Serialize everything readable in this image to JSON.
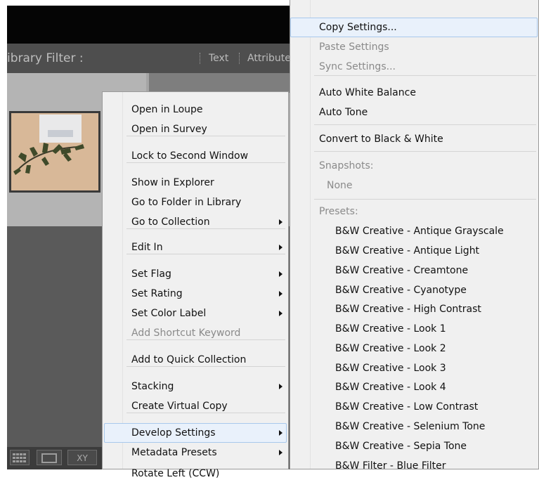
{
  "filter_bar": {
    "label": "ibrary Filter :",
    "tabs": [
      "Text",
      "Attribute"
    ]
  },
  "toolbar": {
    "sort_label": "XY"
  },
  "context_menu": {
    "items": [
      {
        "label": "Open in Loupe",
        "enabled": true,
        "submenu": false
      },
      {
        "label": "Open in Survey",
        "enabled": true,
        "submenu": false
      },
      {
        "label": "Lock to Second Window",
        "enabled": true,
        "submenu": false
      },
      {
        "label": "Show in Explorer",
        "enabled": true,
        "submenu": false
      },
      {
        "label": "Go to Folder in Library",
        "enabled": true,
        "submenu": false
      },
      {
        "label": "Go to Collection",
        "enabled": true,
        "submenu": true
      },
      {
        "label": "Edit In",
        "enabled": true,
        "submenu": true
      },
      {
        "label": "Set Flag",
        "enabled": true,
        "submenu": true
      },
      {
        "label": "Set Rating",
        "enabled": true,
        "submenu": true
      },
      {
        "label": "Set Color Label",
        "enabled": true,
        "submenu": true
      },
      {
        "label": "Add Shortcut Keyword",
        "enabled": false,
        "submenu": false
      },
      {
        "label": "Add to Quick Collection",
        "enabled": true,
        "submenu": false
      },
      {
        "label": "Stacking",
        "enabled": true,
        "submenu": true
      },
      {
        "label": "Create Virtual Copy",
        "enabled": true,
        "submenu": false
      },
      {
        "label": "Develop Settings",
        "enabled": true,
        "submenu": true,
        "highlighted": true
      },
      {
        "label": "Metadata Presets",
        "enabled": true,
        "submenu": true
      },
      {
        "label": "Rotate Left (CCW)",
        "enabled": true,
        "submenu": false
      }
    ]
  },
  "develop_menu": {
    "items": [
      {
        "label": "Copy Settings...",
        "enabled": true,
        "highlighted": true
      },
      {
        "label": "Paste Settings",
        "enabled": false
      },
      {
        "label": "Sync Settings...",
        "enabled": false
      },
      {
        "label": "Auto White Balance",
        "enabled": true
      },
      {
        "label": "Auto Tone",
        "enabled": true
      },
      {
        "label": "Convert to Black & White",
        "enabled": true
      },
      {
        "label": "Snapshots:",
        "enabled": false,
        "header": true
      },
      {
        "label": "None",
        "enabled": false
      },
      {
        "label": "Presets:",
        "enabled": false,
        "header": true
      },
      {
        "label": "B&W Creative - Antique Grayscale",
        "enabled": true
      },
      {
        "label": "B&W Creative - Antique Light",
        "enabled": true
      },
      {
        "label": "B&W Creative - Creamtone",
        "enabled": true
      },
      {
        "label": "B&W Creative - Cyanotype",
        "enabled": true
      },
      {
        "label": "B&W Creative - High Contrast",
        "enabled": true
      },
      {
        "label": "B&W Creative - Look 1",
        "enabled": true
      },
      {
        "label": "B&W Creative - Look 2",
        "enabled": true
      },
      {
        "label": "B&W Creative - Look 3",
        "enabled": true
      },
      {
        "label": "B&W Creative - Look 4",
        "enabled": true
      },
      {
        "label": "B&W Creative - Low Contrast",
        "enabled": true
      },
      {
        "label": "B&W Creative - Selenium Tone",
        "enabled": true
      },
      {
        "label": "B&W Creative - Sepia Tone",
        "enabled": true
      },
      {
        "label": "B&W Filter - Blue Filter",
        "enabled": true
      }
    ]
  },
  "colors": {
    "menu_bg": "#f0f0f0",
    "highlight_bg": "#e9f1fb",
    "highlight_border": "#a8c8ec",
    "disabled_text": "#8a8a8a",
    "panel_dark": "#4e4e4e"
  }
}
